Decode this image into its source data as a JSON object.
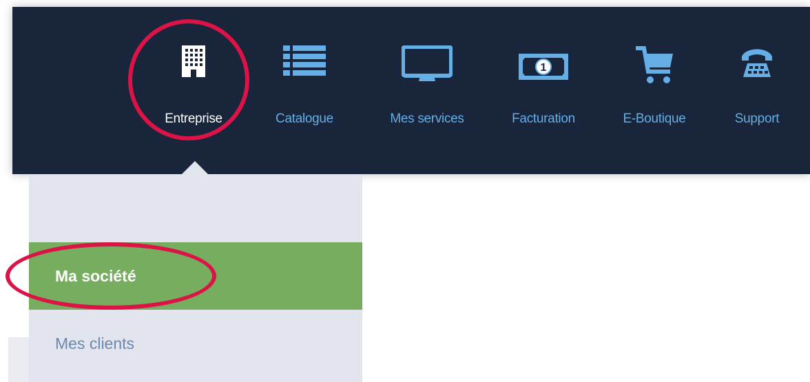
{
  "nav": {
    "items": [
      {
        "label": "Entreprise",
        "icon": "building-icon",
        "active": true
      },
      {
        "label": "Catalogue",
        "icon": "list-icon",
        "active": false
      },
      {
        "label": "Mes services",
        "icon": "monitor-icon",
        "active": false
      },
      {
        "label": "Facturation",
        "icon": "banknote-icon",
        "active": false
      },
      {
        "label": "E-Boutique",
        "icon": "shopping-cart-icon",
        "active": false
      },
      {
        "label": "Support",
        "icon": "telephone-icon",
        "active": false
      }
    ]
  },
  "submenu": {
    "items": [
      {
        "label": "Ma société",
        "active": true
      },
      {
        "label": "Mes clients",
        "active": false
      }
    ]
  },
  "colors": {
    "navbar_bg": "#18253a",
    "nav_label": "#65aee6",
    "nav_active_label": "#ffffff",
    "submenu_bg": "#e2e5ee",
    "submenu_active_bg": "#77ad5e",
    "submenu_label": "#6b88ad",
    "highlight_annotation": "#dc1346"
  }
}
